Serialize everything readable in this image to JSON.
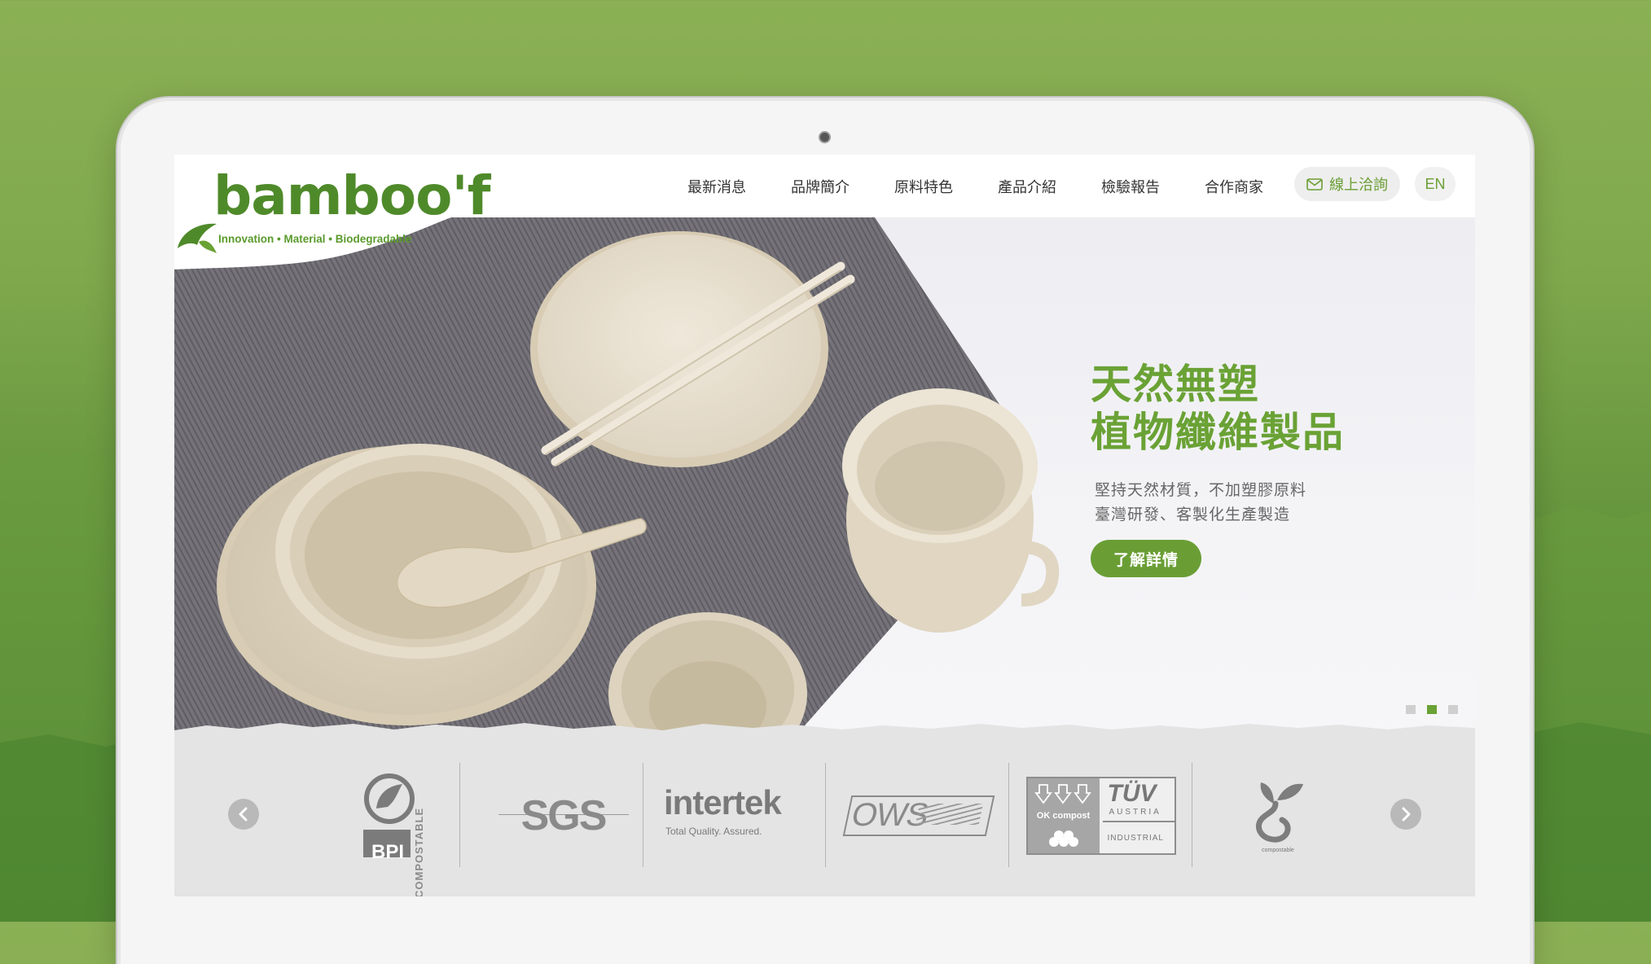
{
  "brand": {
    "name": "bamboo'f",
    "tagline": "Innovation • Material • Biodegradable"
  },
  "nav": {
    "items": [
      "最新消息",
      "品牌簡介",
      "原料特色",
      "產品介紹",
      "檢驗報告",
      "合作商家"
    ],
    "contact_label": "線上洽詢",
    "lang_label": "EN"
  },
  "hero": {
    "title_line1": "天然無塑",
    "title_line2": "植物纖維製品",
    "subtitle_line1": "堅持天然材質，不加塑膠原料",
    "subtitle_line2": "臺灣研發、客製化生產製造",
    "cta_label": "了解詳情",
    "slides_total": 3,
    "slide_active": 2
  },
  "certifications": {
    "bpi": {
      "label": "BPI",
      "side": "COMPOSTABLE"
    },
    "sgs": {
      "label": "SGS"
    },
    "intertek": {
      "label": "intertek",
      "tagline": "Total Quality. Assured."
    },
    "ows": {
      "label": "OWS"
    },
    "tuv": {
      "left": "OK compost",
      "brand": "TÜV",
      "country": "AUSTRIA",
      "type": "INDUSTRIAL"
    },
    "seedling": {
      "label": "compostable"
    }
  },
  "colors": {
    "brand_green": "#6aa235",
    "button_green": "#6a9e35",
    "background_green": "#7fa84c"
  }
}
